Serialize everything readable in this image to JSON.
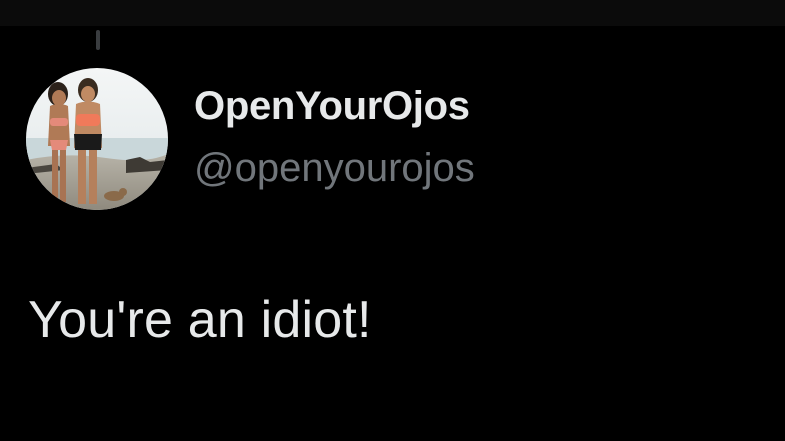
{
  "colors": {
    "background": "#000000",
    "primary_text": "#e7e9ea",
    "secondary_text": "#71767b",
    "thread_line": "#3a3d40"
  },
  "author": {
    "display_name": "OpenYourOjos",
    "handle": "@openyourojos",
    "avatar_icon": "profile-photo-icon"
  },
  "tweet": {
    "text": "You're an idiot!"
  }
}
